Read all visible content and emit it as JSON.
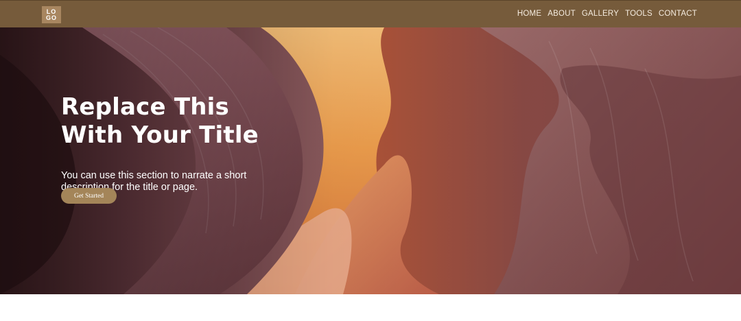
{
  "header": {
    "logo_line1": "LO",
    "logo_line2": "GO",
    "nav": [
      "HOME",
      "ABOUT",
      "GALLERY",
      "TOOLS",
      "CONTACT"
    ]
  },
  "hero": {
    "title": "Replace This\nWith Your Title",
    "description": "You can use this section to narrate a short\ndescription for the title or page.",
    "cta_label": "Get Started"
  },
  "colors": {
    "header_bg": "#765b3b",
    "cta_bg": "#a48559",
    "text": "#ffffff"
  }
}
